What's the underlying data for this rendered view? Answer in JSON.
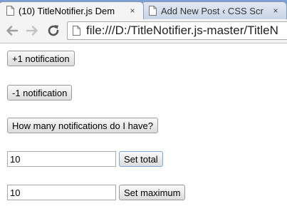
{
  "browser": {
    "tabs": [
      {
        "title": "(10) TitleNotifier.js Dem",
        "close": "×",
        "active": true
      },
      {
        "title": "Add New Post ‹ CSS Scr",
        "close": "×",
        "active": false
      }
    ],
    "address": "file:///D:/TitleNotifier.js-master/TitleN",
    "icons": {
      "back": "back-arrow",
      "forward": "forward-arrow",
      "reload": "reload",
      "page": "page"
    }
  },
  "page": {
    "increment_label": "+1 notification",
    "decrement_label": "-1 notification",
    "query_label": "How many notifications do I have?",
    "total": {
      "value": "10",
      "button_label": "Set total"
    },
    "maximum": {
      "value": "10",
      "button_label": "Set maximum"
    }
  }
}
